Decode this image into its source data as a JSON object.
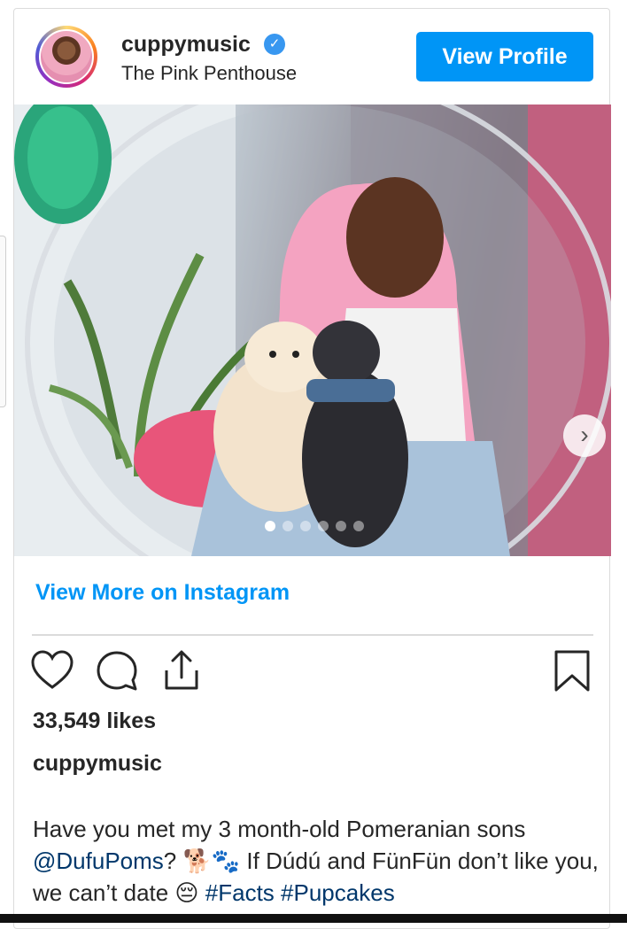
{
  "post": {
    "username": "cuppymusic",
    "location": "The Pink Penthouse",
    "view_profile_label": "View Profile",
    "view_more_label": "View More on Instagram",
    "likes": "33,549 likes",
    "caption_user": "cuppymusic",
    "caption_line1": "Have you met my 3 month-old Pomeranian sons",
    "mention": "@DufuPoms",
    "caption_mid": "? 🐕🐾 If Dúdú and FünFün don’t like you, we can’t date 😔",
    "hashtags": [
      "#Facts",
      "#Pupcakes"
    ],
    "carousel": {
      "slide_count": 6,
      "active_index": 0
    }
  },
  "icons": {
    "verified": "verified-badge-icon",
    "like": "heart-icon",
    "comment": "comment-bubble-icon",
    "share": "share-icon",
    "save": "bookmark-icon",
    "next": "chevron-right-icon"
  },
  "colors": {
    "primary_button": "#0095f6",
    "link": "#00376b",
    "verified": "#3897f0",
    "text": "#262626",
    "border": "#dbdbdb"
  }
}
